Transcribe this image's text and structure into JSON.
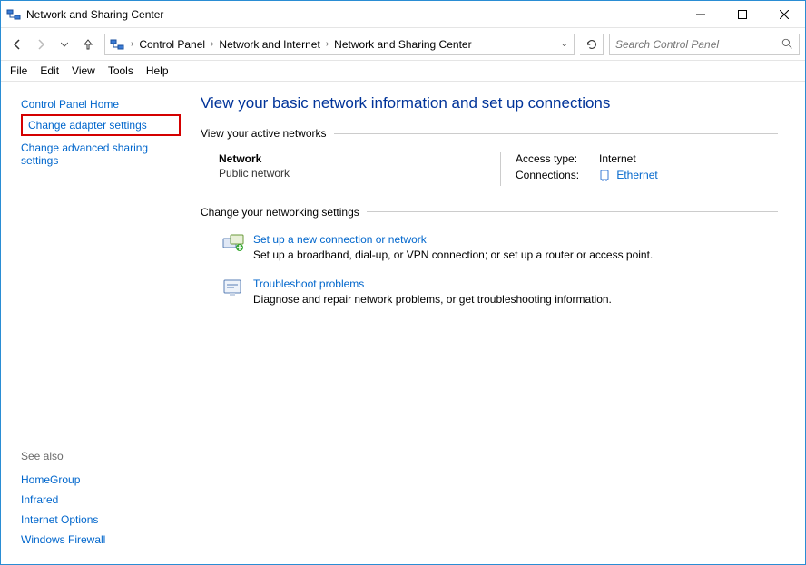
{
  "window": {
    "title": "Network and Sharing Center"
  },
  "nav": {
    "back_disabled": false,
    "forward_disabled": true
  },
  "breadcrumb": {
    "items": [
      "Control Panel",
      "Network and Internet",
      "Network and Sharing Center"
    ]
  },
  "search": {
    "placeholder": "Search Control Panel"
  },
  "menu": {
    "file": "File",
    "edit": "Edit",
    "view": "View",
    "tools": "Tools",
    "help": "Help"
  },
  "sidebar": {
    "home": "Control Panel Home",
    "adapter": "Change adapter settings",
    "advanced": "Change advanced sharing settings",
    "see_also_title": "See also",
    "see_also": {
      "homegroup": "HomeGroup",
      "infrared": "Infrared",
      "internet_options": "Internet Options",
      "firewall": "Windows Firewall"
    }
  },
  "main": {
    "heading": "View your basic network information and set up connections",
    "active_networks_label": "View your active networks",
    "network": {
      "name": "Network",
      "type": "Public network",
      "access_type_label": "Access type:",
      "access_type_value": "Internet",
      "connections_label": "Connections:",
      "connection_link": "Ethernet"
    },
    "change_settings_label": "Change your networking settings",
    "setup": {
      "title": "Set up a new connection or network",
      "desc": "Set up a broadband, dial-up, or VPN connection; or set up a router or access point."
    },
    "troubleshoot": {
      "title": "Troubleshoot problems",
      "desc": "Diagnose and repair network problems, or get troubleshooting information."
    }
  }
}
